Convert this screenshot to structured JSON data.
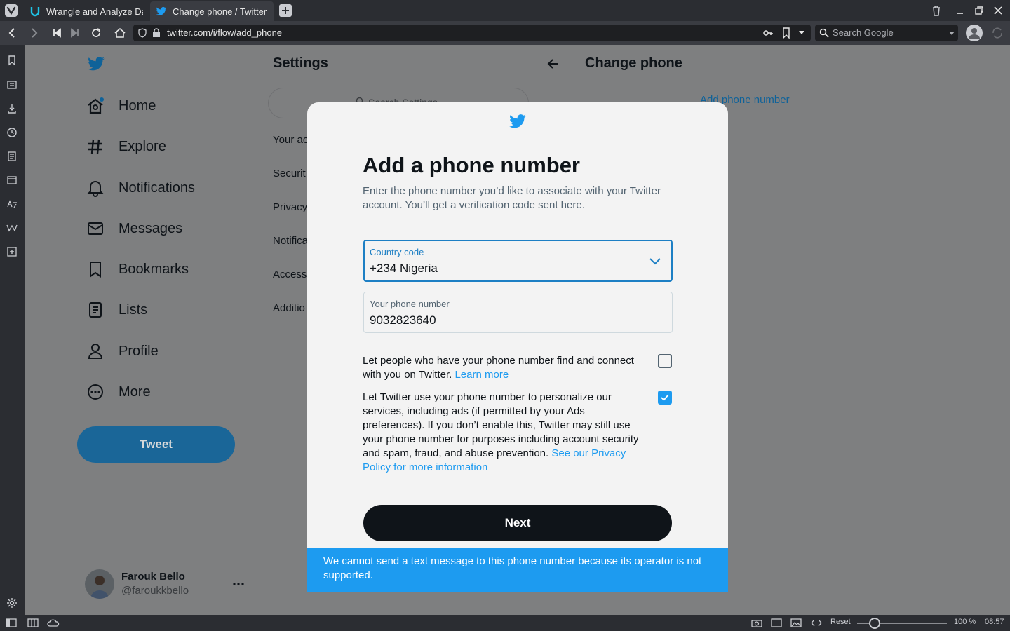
{
  "browser": {
    "tabs": [
      {
        "title": "Wrangle and Analyze Dat",
        "active": false
      },
      {
        "title": "Change phone / Twitter",
        "active": true
      }
    ],
    "url": "twitter.com/i/flow/add_phone",
    "search_placeholder": "Search Google",
    "status": {
      "reset_label": "Reset",
      "zoom": "100 %",
      "clock": "08:57"
    }
  },
  "twitter": {
    "nav": [
      {
        "label": "Home",
        "icon": "home-icon"
      },
      {
        "label": "Explore",
        "icon": "hashtag-icon"
      },
      {
        "label": "Notifications",
        "icon": "bell-icon"
      },
      {
        "label": "Messages",
        "icon": "mail-icon"
      },
      {
        "label": "Bookmarks",
        "icon": "bookmark-icon"
      },
      {
        "label": "Lists",
        "icon": "list-icon"
      },
      {
        "label": "Profile",
        "icon": "person-icon"
      },
      {
        "label": "More",
        "icon": "more-circle-icon"
      }
    ],
    "tweet_button": "Tweet",
    "user": {
      "name": "Farouk Bello",
      "handle": "@faroukkbello"
    },
    "settings": {
      "title": "Settings",
      "search_placeholder": "Search Settings",
      "items": [
        "Your ac",
        "Securit",
        "Privacy",
        "Notifica",
        "Access",
        "Additio"
      ]
    },
    "detail": {
      "title": "Change phone",
      "add_phone_link": "Add phone number"
    }
  },
  "modal": {
    "title": "Add a phone number",
    "description": "Enter the phone number you’d like to associate with your Twitter account. You’ll get a verification code sent here.",
    "country_label": "Country code",
    "country_value": "+234 Nigeria",
    "phone_label": "Your phone number",
    "phone_value": "9032823640",
    "option1_text": "Let people who have your phone number find and connect with you on Twitter.",
    "option1_link": "Learn more",
    "option1_checked": false,
    "option2_text": "Let Twitter use your phone number to personalize our services, including ads (if permitted by your Ads preferences). If you don’t enable this, Twitter may still use your phone number for purposes including account security and spam, fraud, and abuse prevention.",
    "option2_link": "See our Privacy Policy for more information",
    "option2_checked": true,
    "next_button": "Next",
    "toast": "We cannot send a text message to this phone number because its operator is not supported."
  },
  "colors": {
    "accent": "#1d9bf0",
    "focus_border": "#1d7fc4",
    "button": "#0f1419"
  }
}
